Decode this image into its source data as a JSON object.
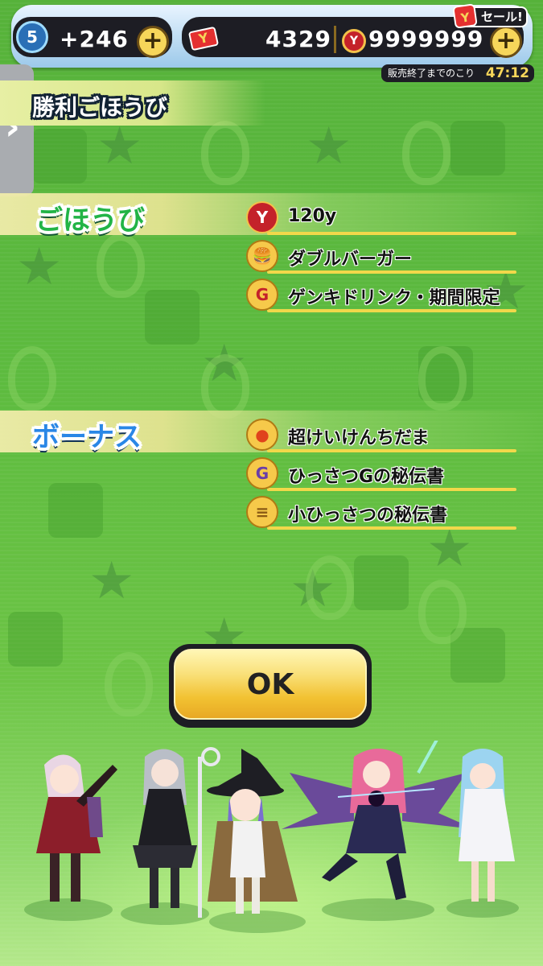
{
  "hud": {
    "level": "5",
    "stamina": "+246",
    "plus_symbol": "+",
    "card_icon_letter": "Y",
    "yokai_money": "4329",
    "coin_icon_letter": "Y",
    "coins": "9999999",
    "sale_icon_letter": "Y",
    "sale_label": "セール!",
    "timer_label": "販売終了までのこり",
    "timer_value": "47:12"
  },
  "side_tab": {
    "arrow": "›"
  },
  "header": {
    "title": "勝利ごほうび"
  },
  "rewards": {
    "title": "ごほうび",
    "items": [
      {
        "label": "120y",
        "icon": "y-money-icon",
        "glyph": "Y"
      },
      {
        "label": "ダブルバーガー",
        "icon": "burger-icon",
        "glyph": "🍔"
      },
      {
        "label": "ゲンキドリンク・期間限定",
        "icon": "drink-icon",
        "glyph": "G"
      }
    ]
  },
  "bonus": {
    "title": "ボーナス",
    "items": [
      {
        "label": "超けいけんちだま",
        "icon": "exp-orb-icon",
        "glyph": "●"
      },
      {
        "label": "ひっさつGの秘伝書",
        "icon": "scroll-g-icon",
        "glyph": "G"
      },
      {
        "label": "小ひっさつの秘伝書",
        "icon": "scroll-small-icon",
        "glyph": "≡"
      }
    ]
  },
  "ok_button": {
    "label": "OK"
  },
  "colors": {
    "background": "#5dbb3f",
    "rewards_title": "#22b446",
    "bonus_title": "#2a87e6",
    "item_underline": "#f1d84a",
    "ok_button": "#f2c232"
  }
}
